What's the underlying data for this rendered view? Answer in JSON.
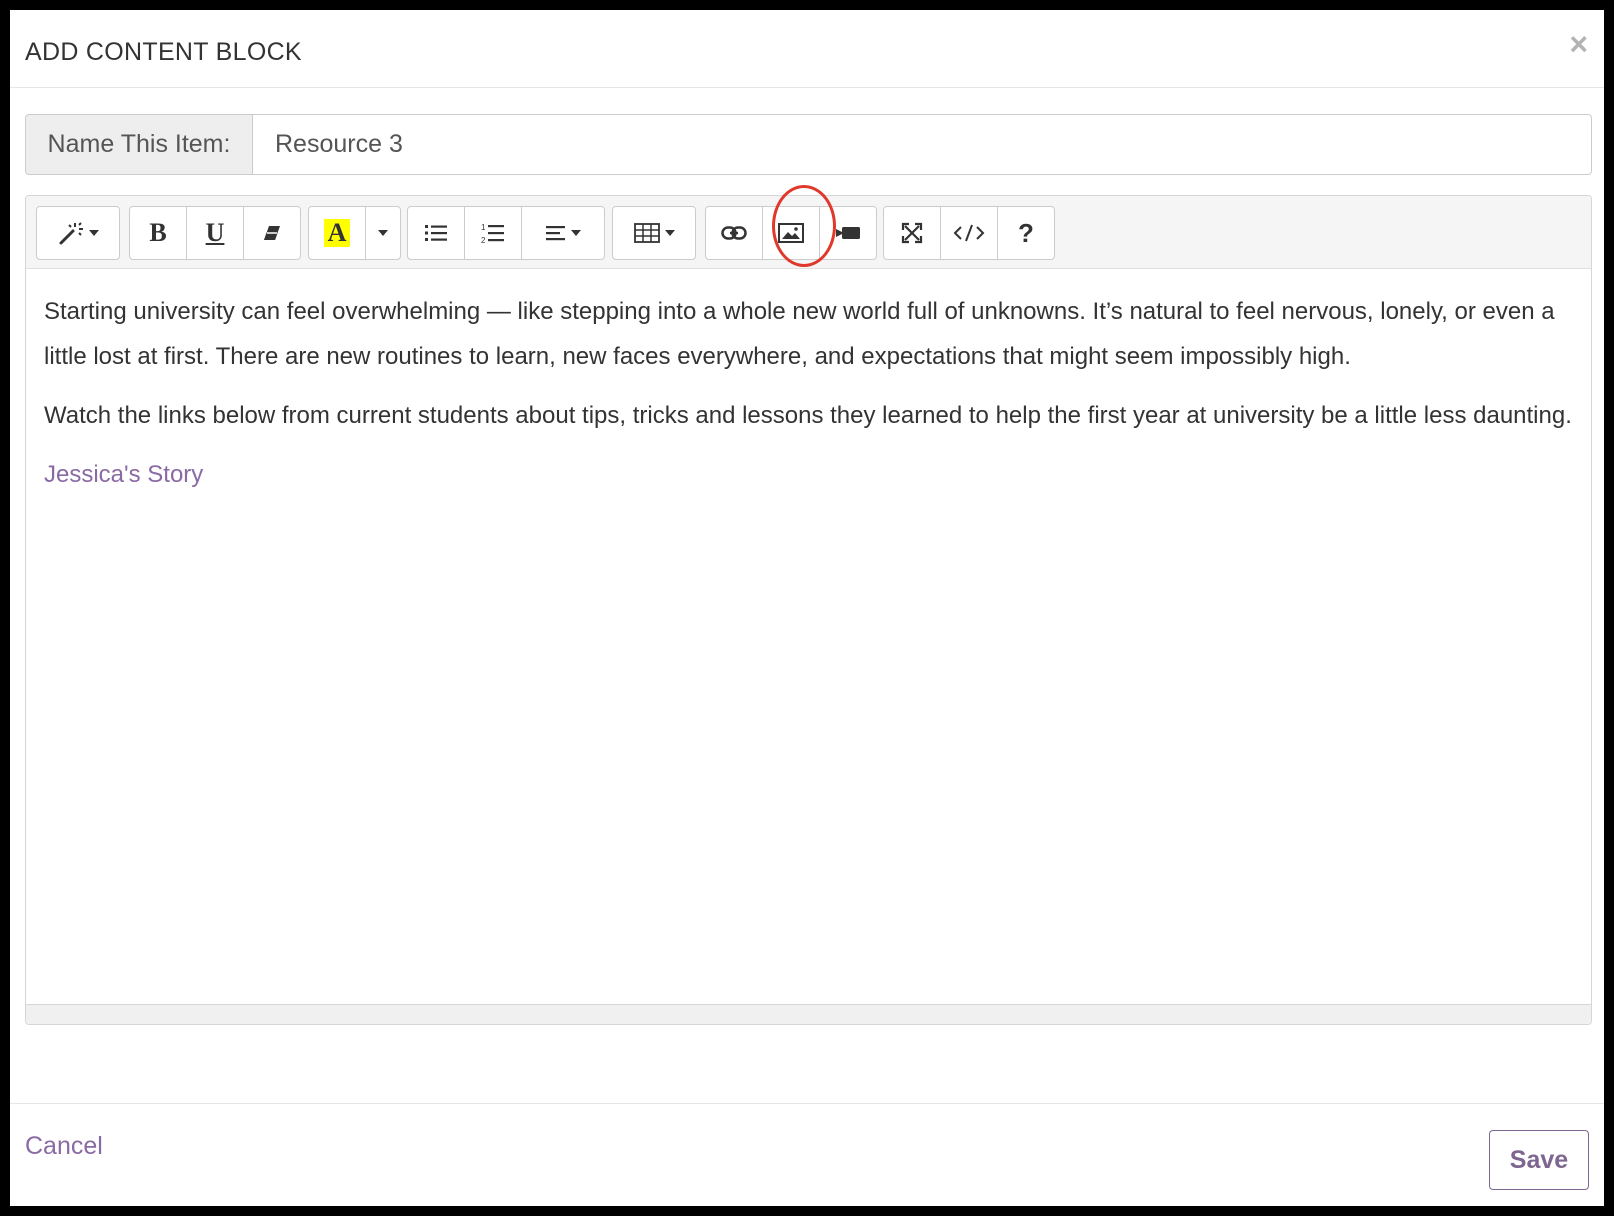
{
  "modal": {
    "title": "ADD CONTENT BLOCK",
    "close_glyph": "×"
  },
  "name_field": {
    "label": "Name This Item:",
    "value": "Resource 3"
  },
  "toolbar": {
    "groups": [
      [
        "magic-wand-style-icon"
      ],
      [
        "bold-icon",
        "underline-icon",
        "eraser-clear-format-icon"
      ],
      [
        "text-color-a-icon",
        "color-dropdown-caret-icon"
      ],
      [
        "bullet-list-icon",
        "numbered-list-icon",
        "align-left-dropdown-icon"
      ],
      [
        "table-icon"
      ],
      [
        "link-icon",
        "picture-icon",
        "video-camera-icon"
      ],
      [
        "fullscreen-icon",
        "code-view-icon",
        "help-question-icon"
      ]
    ],
    "highlight_color": "#ffff00",
    "callout_ring_color": "#e0392b"
  },
  "content": {
    "paragraph_1": "Starting university can feel overwhelming — like stepping into a whole new world full of unknowns. It’s natural to feel nervous, lonely, or even a little lost at first. There are new routines to learn, new faces everywhere, and expectations that might seem impossibly high.",
    "paragraph_2": "Watch the links below from current students about tips, tricks and lessons they learned to help the first year at university be a little less daunting.",
    "link_text": "Jessica's Story"
  },
  "footer": {
    "cancel_label": "Cancel",
    "save_label": "Save"
  },
  "colors": {
    "accent": "#7e6691",
    "link": "#8a6aa3",
    "text": "#333333"
  }
}
